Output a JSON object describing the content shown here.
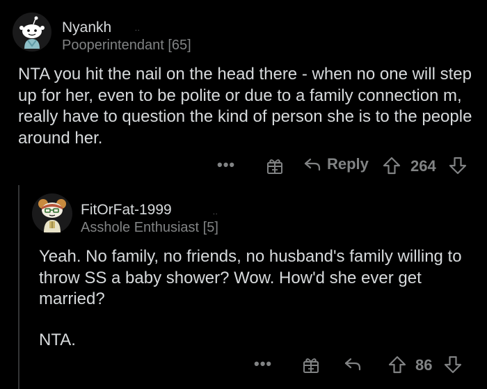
{
  "comments": [
    {
      "username": "Nyankh",
      "edited_marker": "..",
      "flair": "Pooperintendant [65]",
      "body": "NTA you hit the nail on the head there - when no one will step up for her, even to be polite or due to a family connection m, really have to question the kind of person she is to the people around her.",
      "actions": {
        "more": "•••",
        "reply_label": "Reply",
        "vote_count": "264"
      }
    },
    {
      "username": "FitOrFat-1999",
      "edited_marker": "..",
      "flair": "Asshole Enthusiast [5]",
      "body_paragraphs": [
        "Yeah. No family, no friends, no husband's family willing to throw SS a baby shower? Wow. How'd she ever get married?",
        "NTA."
      ],
      "actions": {
        "more": "•••",
        "vote_count": "86"
      }
    }
  ],
  "icons": {
    "award": "gift-award-icon",
    "reply": "reply-arrow-icon",
    "upvote": "upvote-arrow-icon",
    "downvote": "downvote-arrow-icon"
  },
  "colors": {
    "background": "#000000",
    "text": "#d7dadc",
    "muted": "#818384",
    "thread_line": "#343536"
  }
}
